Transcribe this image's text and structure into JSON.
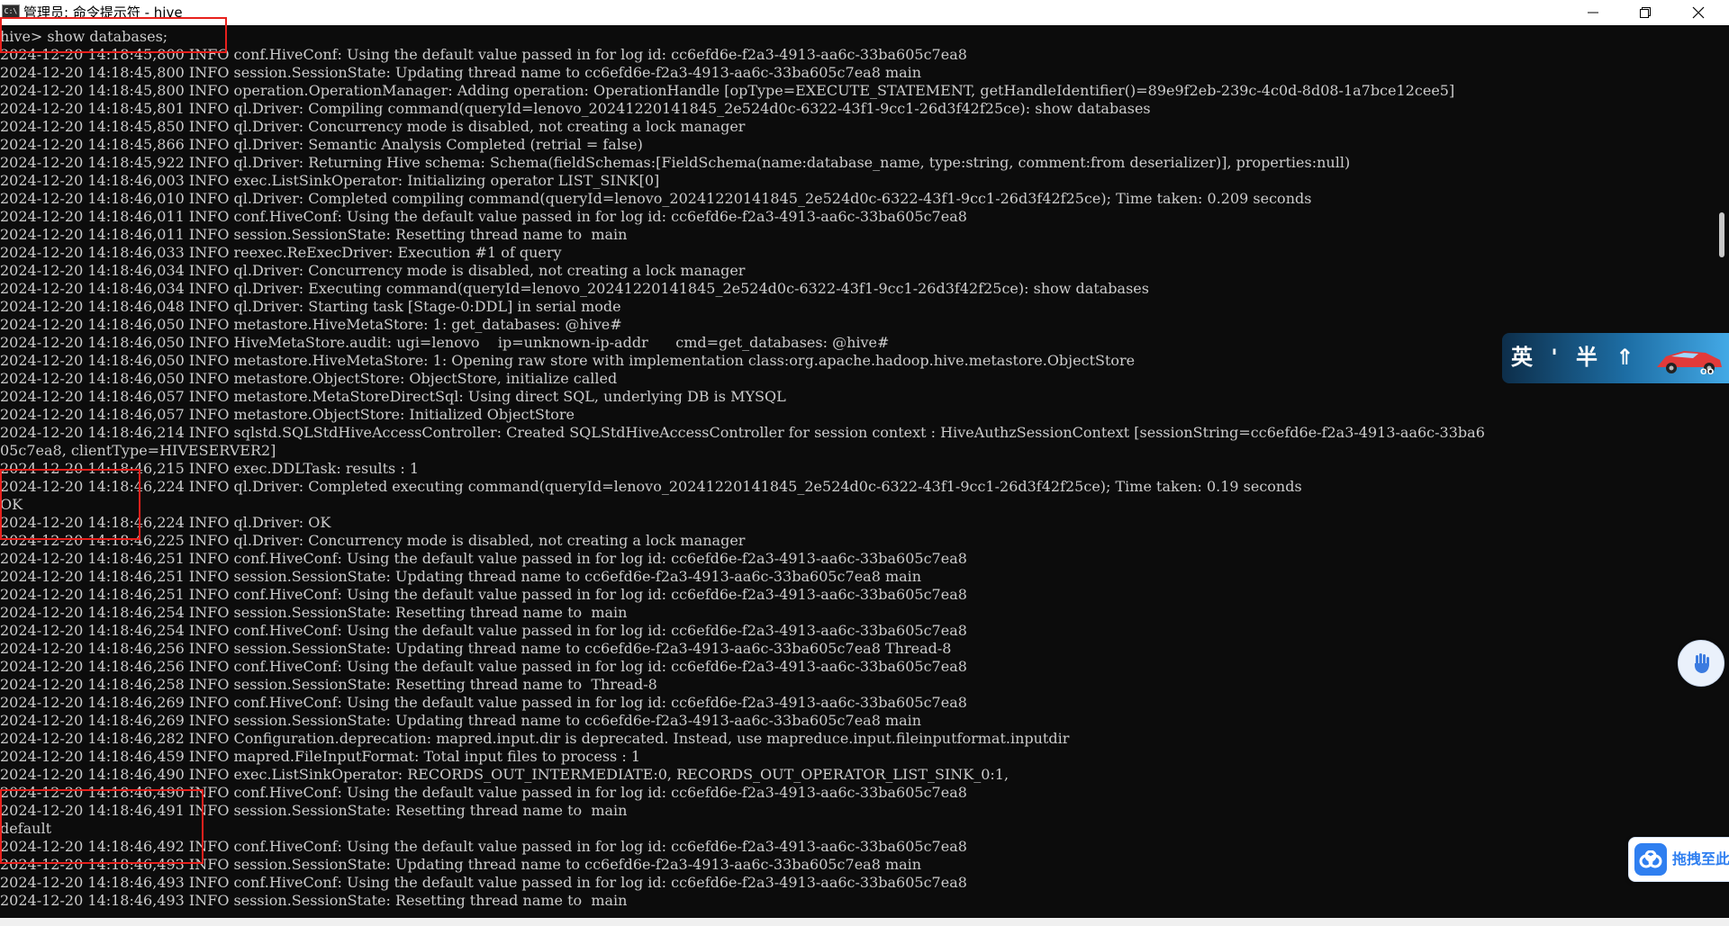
{
  "window": {
    "title": "管理员: 命令提示符 - hive",
    "icon_text": "C:\\"
  },
  "console": {
    "lines": [
      "hive> show databases;",
      "2024-12-20 14:18:45,800 INFO conf.HiveConf: Using the default value passed in for log id: cc6efd6e-f2a3-4913-aa6c-33ba605c7ea8",
      "2024-12-20 14:18:45,800 INFO session.SessionState: Updating thread name to cc6efd6e-f2a3-4913-aa6c-33ba605c7ea8 main",
      "2024-12-20 14:18:45,800 INFO operation.OperationManager: Adding operation: OperationHandle [opType=EXECUTE_STATEMENT, getHandleIdentifier()=89e9f2eb-239c-4c0d-8d08-1a7bce12cee5]",
      "2024-12-20 14:18:45,801 INFO ql.Driver: Compiling command(queryId=lenovo_20241220141845_2e524d0c-6322-43f1-9cc1-26d3f42f25ce): show databases",
      "2024-12-20 14:18:45,850 INFO ql.Driver: Concurrency mode is disabled, not creating a lock manager",
      "2024-12-20 14:18:45,866 INFO ql.Driver: Semantic Analysis Completed (retrial = false)",
      "2024-12-20 14:18:45,922 INFO ql.Driver: Returning Hive schema: Schema(fieldSchemas:[FieldSchema(name:database_name, type:string, comment:from deserializer)], properties:null)",
      "2024-12-20 14:18:46,003 INFO exec.ListSinkOperator: Initializing operator LIST_SINK[0]",
      "2024-12-20 14:18:46,010 INFO ql.Driver: Completed compiling command(queryId=lenovo_20241220141845_2e524d0c-6322-43f1-9cc1-26d3f42f25ce); Time taken: 0.209 seconds",
      "2024-12-20 14:18:46,011 INFO conf.HiveConf: Using the default value passed in for log id: cc6efd6e-f2a3-4913-aa6c-33ba605c7ea8",
      "2024-12-20 14:18:46,011 INFO session.SessionState: Resetting thread name to  main",
      "2024-12-20 14:18:46,033 INFO reexec.ReExecDriver: Execution #1 of query",
      "2024-12-20 14:18:46,034 INFO ql.Driver: Concurrency mode is disabled, not creating a lock manager",
      "2024-12-20 14:18:46,034 INFO ql.Driver: Executing command(queryId=lenovo_20241220141845_2e524d0c-6322-43f1-9cc1-26d3f42f25ce): show databases",
      "2024-12-20 14:18:46,048 INFO ql.Driver: Starting task [Stage-0:DDL] in serial mode",
      "2024-12-20 14:18:46,050 INFO metastore.HiveMetaStore: 1: get_databases: @hive#",
      "2024-12-20 14:18:46,050 INFO HiveMetaStore.audit: ugi=lenovo    ip=unknown-ip-addr      cmd=get_databases: @hive#",
      "2024-12-20 14:18:46,050 INFO metastore.HiveMetaStore: 1: Opening raw store with implementation class:org.apache.hadoop.hive.metastore.ObjectStore",
      "2024-12-20 14:18:46,050 INFO metastore.ObjectStore: ObjectStore, initialize called",
      "2024-12-20 14:18:46,057 INFO metastore.MetaStoreDirectSql: Using direct SQL, underlying DB is MYSQL",
      "2024-12-20 14:18:46,057 INFO metastore.ObjectStore: Initialized ObjectStore",
      "2024-12-20 14:18:46,214 INFO sqlstd.SQLStdHiveAccessController: Created SQLStdHiveAccessController for session context : HiveAuthzSessionContext [sessionString=cc6efd6e-f2a3-4913-aa6c-33ba6",
      "05c7ea8, clientType=HIVESERVER2]",
      "2024-12-20 14:18:46,215 INFO exec.DDLTask: results : 1",
      "2024-12-20 14:18:46,224 INFO ql.Driver: Completed executing command(queryId=lenovo_20241220141845_2e524d0c-6322-43f1-9cc1-26d3f42f25ce); Time taken: 0.19 seconds",
      "OK",
      "2024-12-20 14:18:46,224 INFO ql.Driver: OK",
      "2024-12-20 14:18:46,225 INFO ql.Driver: Concurrency mode is disabled, not creating a lock manager",
      "2024-12-20 14:18:46,251 INFO conf.HiveConf: Using the default value passed in for log id: cc6efd6e-f2a3-4913-aa6c-33ba605c7ea8",
      "2024-12-20 14:18:46,251 INFO session.SessionState: Updating thread name to cc6efd6e-f2a3-4913-aa6c-33ba605c7ea8 main",
      "2024-12-20 14:18:46,251 INFO conf.HiveConf: Using the default value passed in for log id: cc6efd6e-f2a3-4913-aa6c-33ba605c7ea8",
      "2024-12-20 14:18:46,254 INFO session.SessionState: Resetting thread name to  main",
      "2024-12-20 14:18:46,254 INFO conf.HiveConf: Using the default value passed in for log id: cc6efd6e-f2a3-4913-aa6c-33ba605c7ea8",
      "2024-12-20 14:18:46,256 INFO session.SessionState: Updating thread name to cc6efd6e-f2a3-4913-aa6c-33ba605c7ea8 Thread-8",
      "2024-12-20 14:18:46,256 INFO conf.HiveConf: Using the default value passed in for log id: cc6efd6e-f2a3-4913-aa6c-33ba605c7ea8",
      "2024-12-20 14:18:46,258 INFO session.SessionState: Resetting thread name to  Thread-8",
      "2024-12-20 14:18:46,269 INFO conf.HiveConf: Using the default value passed in for log id: cc6efd6e-f2a3-4913-aa6c-33ba605c7ea8",
      "2024-12-20 14:18:46,269 INFO session.SessionState: Updating thread name to cc6efd6e-f2a3-4913-aa6c-33ba605c7ea8 main",
      "2024-12-20 14:18:46,282 INFO Configuration.deprecation: mapred.input.dir is deprecated. Instead, use mapreduce.input.fileinputformat.inputdir",
      "2024-12-20 14:18:46,459 INFO mapred.FileInputFormat: Total input files to process : 1",
      "2024-12-20 14:18:46,490 INFO exec.ListSinkOperator: RECORDS_OUT_INTERMEDIATE:0, RECORDS_OUT_OPERATOR_LIST_SINK_0:1,",
      "2024-12-20 14:18:46,490 INFO conf.HiveConf: Using the default value passed in for log id: cc6efd6e-f2a3-4913-aa6c-33ba605c7ea8",
      "2024-12-20 14:18:46,491 INFO session.SessionState: Resetting thread name to  main",
      "default",
      "2024-12-20 14:18:46,492 INFO conf.HiveConf: Using the default value passed in for log id: cc6efd6e-f2a3-4913-aa6c-33ba605c7ea8",
      "2024-12-20 14:18:46,493 INFO session.SessionState: Updating thread name to cc6efd6e-f2a3-4913-aa6c-33ba605c7ea8 main",
      "2024-12-20 14:18:46,493 INFO conf.HiveConf: Using the default value passed in for log id: cc6efd6e-f2a3-4913-aa6c-33ba605c7ea8",
      "2024-12-20 14:18:46,493 INFO session.SessionState: Resetting thread name to  main"
    ]
  },
  "ime": {
    "chars": "英 ' 半 ⇑",
    "badge": "OO"
  },
  "baidu": {
    "label": "拖拽至此"
  },
  "colors": {
    "console_bg": "#0c0c0c",
    "console_text": "#cccccc",
    "highlight_box": "#e8201c",
    "baidu_accent": "#2f7ff0"
  }
}
